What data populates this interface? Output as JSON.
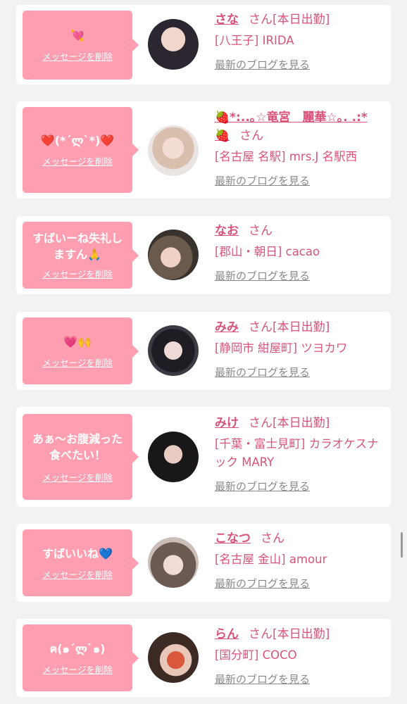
{
  "common": {
    "delete_label": "メッセージを削除",
    "san": "さん",
    "blog_label": "最新のブログを見る"
  },
  "cards": [
    {
      "message": "💘",
      "name": "さな",
      "status": "[本日出勤]",
      "area": "[八王子] IRIDA"
    },
    {
      "message": "❤️(*´ლ`*)❤️",
      "name": "🍓*:..｡☆竜宮　麗華☆｡. .:*🍓",
      "status": "",
      "area": "[名古屋 名駅] mrs.J 名駅西"
    },
    {
      "message": "すばいーね失礼しますん🙏",
      "name": "なお",
      "status": "",
      "area": "[郡山・朝日] cacao"
    },
    {
      "message": "💗🙌",
      "name": "みみ",
      "status": "[本日出勤]",
      "area": "[静岡市 紺屋町] ツヨカワ"
    },
    {
      "message": "あぁ～お腹減った食べたい！",
      "name": "みけ",
      "status": "[本日出勤]",
      "area": "[千葉・富士見町] カラオケスナック MARY"
    },
    {
      "message": "すばいいね💙",
      "name": "こなつ",
      "status": "",
      "area": "[名古屋 金山] amour"
    },
    {
      "message": "ฅ(๑´ლ`๑)",
      "name": "らん",
      "status": "[本日出勤]",
      "area": "[国分町] COCO"
    }
  ]
}
